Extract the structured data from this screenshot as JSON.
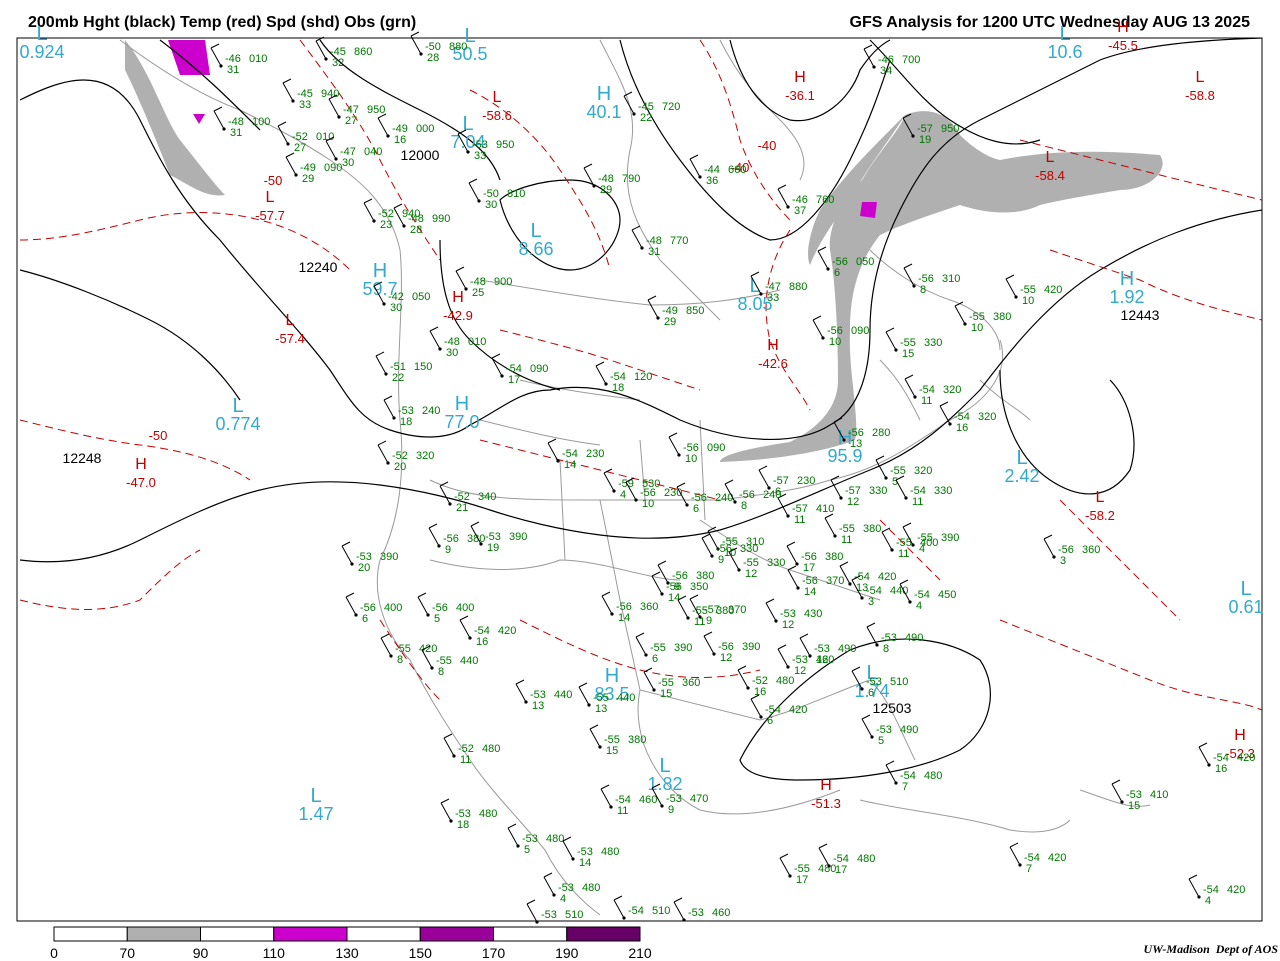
{
  "header": {
    "title_left": "200mb Hght (black) Temp (red) Spd (shd) Obs (grn)",
    "title_right": "GFS Analysis for 1200 UTC Wednesday  AUG 13 2025"
  },
  "colors": {
    "height_contour": "#000000",
    "temp_contour": "#c00000",
    "obs": "#007700",
    "centers": "#33aacc",
    "borders": "#9a9a9a",
    "speed_70_90": "#b0b0b0",
    "speed_110_130": "#cc00cc",
    "speed_150_170": "#990099",
    "speed_190_210": "#660066"
  },
  "colorbar": {
    "labels": [
      "0",
      "70",
      "90",
      "110",
      "130",
      "150",
      "170",
      "190",
      "210"
    ],
    "fills": [
      "#ffffff",
      "#b0b0b0",
      "#ffffff",
      "#cc00cc",
      "#ffffff",
      "#990099",
      "#ffffff",
      "#660066"
    ]
  },
  "credit": {
    "org": "UW-Madison",
    "dept": "Dept of AOS"
  },
  "height_labels": [
    "12000",
    "12240",
    "12248",
    "12443",
    "12503"
  ],
  "pressure_centers": [
    {
      "letter": "L",
      "value": "0.924",
      "color": "cyan"
    },
    {
      "letter": "L",
      "value": "50.5",
      "color": "cyan"
    },
    {
      "letter": "H",
      "value": "40.1",
      "color": "cyan"
    },
    {
      "letter": "L",
      "value": "7.04",
      "color": "cyan"
    },
    {
      "letter": "L",
      "value": "8.66",
      "color": "cyan"
    },
    {
      "letter": "H",
      "value": "59.7",
      "color": "cyan"
    },
    {
      "letter": "L",
      "value": "0.774",
      "color": "cyan"
    },
    {
      "letter": "H",
      "value": "77.0",
      "color": "cyan"
    },
    {
      "letter": "L",
      "value": "8.05",
      "color": "cyan"
    },
    {
      "letter": "L",
      "value": "10.6",
      "color": "cyan"
    },
    {
      "letter": "L",
      "value": "2.42",
      "color": "cyan"
    },
    {
      "letter": "H",
      "value": "95.9",
      "color": "cyan"
    },
    {
      "letter": "L",
      "value": "1.47",
      "color": "cyan"
    },
    {
      "letter": "H",
      "value": "83.5",
      "color": "cyan"
    },
    {
      "letter": "L",
      "value": "1.82",
      "color": "cyan"
    },
    {
      "letter": "L",
      "value": "1.74",
      "color": "cyan"
    },
    {
      "letter": "L",
      "value": "0.61",
      "color": "cyan"
    },
    {
      "letter": "H",
      "value": "1.92",
      "color": "cyan"
    },
    {
      "letter": "L",
      "value": "-57.7",
      "color": "red"
    },
    {
      "letter": "L",
      "value": "-57.4",
      "color": "red"
    },
    {
      "letter": "H",
      "value": "-47.0",
      "color": "red"
    },
    {
      "letter": "H",
      "value": "-42.9",
      "color": "red"
    },
    {
      "letter": "L",
      "value": "-58.6",
      "color": "red"
    },
    {
      "letter": "H",
      "value": "-42.6",
      "color": "red"
    },
    {
      "letter": "L",
      "value": "-58.4",
      "color": "red"
    },
    {
      "letter": "L",
      "value": "-58.8",
      "color": "red"
    },
    {
      "letter": "H",
      "value": "-45.5",
      "color": "red"
    },
    {
      "letter": "L",
      "value": "-58.2",
      "color": "red"
    },
    {
      "letter": "H",
      "value": "-51.3",
      "color": "red"
    },
    {
      "letter": "H",
      "value": "-52.3",
      "color": "red"
    },
    {
      "letter": "H",
      "value": "-36.1",
      "color": "red"
    },
    {
      "letter": "",
      "value": "-50",
      "color": "red"
    },
    {
      "letter": "",
      "value": "-50",
      "color": "red"
    },
    {
      "letter": "",
      "value": "-40",
      "color": "red"
    },
    {
      "letter": "",
      "value": "-40",
      "color": "red"
    }
  ],
  "observations": [
    {
      "t": "-45",
      "h": "860",
      "s": "32"
    },
    {
      "t": "-50",
      "h": "880",
      "s": "28"
    },
    {
      "t": "-46",
      "h": "010",
      "s": "31"
    },
    {
      "t": "-45",
      "h": "940",
      "s": "33"
    },
    {
      "t": "-47",
      "h": "950",
      "s": "27"
    },
    {
      "t": "-48",
      "h": "100",
      "s": "31"
    },
    {
      "t": "-52",
      "h": "010",
      "s": "27"
    },
    {
      "t": "-49",
      "h": "000",
      "s": "16"
    },
    {
      "t": "-47",
      "h": "040",
      "s": "30"
    },
    {
      "t": "-49",
      "h": "090",
      "s": "29"
    },
    {
      "t": "-53",
      "h": "950",
      "s": "33"
    },
    {
      "t": "-50",
      "h": "810",
      "s": "30"
    },
    {
      "t": "-52",
      "h": "940",
      "s": "23"
    },
    {
      "t": "-48",
      "h": "990",
      "s": "28"
    },
    {
      "t": "-48",
      "h": "900",
      "s": "25"
    },
    {
      "t": "-42",
      "h": "050",
      "s": "30"
    },
    {
      "t": "-48",
      "h": "010",
      "s": "30"
    },
    {
      "t": "-51",
      "h": "150",
      "s": "22"
    },
    {
      "t": "-54",
      "h": "090",
      "s": "17"
    },
    {
      "t": "-53",
      "h": "240",
      "s": "18"
    },
    {
      "t": "-52",
      "h": "320",
      "s": "20"
    },
    {
      "t": "-52",
      "h": "340",
      "s": "21"
    },
    {
      "t": "-54",
      "h": "230",
      "s": "14"
    },
    {
      "t": "-54",
      "h": "120",
      "s": "18"
    },
    {
      "t": "-48",
      "h": "770",
      "s": "31"
    },
    {
      "t": "-49",
      "h": "850",
      "s": "29"
    },
    {
      "t": "-48",
      "h": "790",
      "s": "29"
    },
    {
      "t": "-45",
      "h": "720",
      "s": "22"
    },
    {
      "t": "-44",
      "h": "660",
      "s": "36"
    },
    {
      "t": "-46",
      "h": "760",
      "s": "37"
    },
    {
      "t": "-47",
      "h": "880",
      "s": "33"
    },
    {
      "t": "-46",
      "h": "700",
      "s": "34"
    },
    {
      "t": "-57",
      "h": "950",
      "s": "19"
    },
    {
      "t": "-56",
      "h": "050",
      "s": "6"
    },
    {
      "t": "-56",
      "h": "310",
      "s": "8"
    },
    {
      "t": "-55",
      "h": "420",
      "s": "10"
    },
    {
      "t": "-56",
      "h": "090",
      "s": "10"
    },
    {
      "t": "-55",
      "h": "330",
      "s": "15"
    },
    {
      "t": "-55",
      "h": "380",
      "s": "10"
    },
    {
      "t": "-54",
      "h": "320",
      "s": "11"
    },
    {
      "t": "-54",
      "h": "320",
      "s": "16"
    },
    {
      "t": "-56",
      "h": "280",
      "s": "13"
    },
    {
      "t": "-55",
      "h": "320",
      "s": "5"
    },
    {
      "t": "-54",
      "h": "330",
      "s": "11"
    },
    {
      "t": "-56",
      "h": "090",
      "s": "10"
    },
    {
      "t": "-57",
      "h": "230",
      "s": "6"
    },
    {
      "t": "-57",
      "h": "330",
      "s": "12"
    },
    {
      "t": "-57",
      "h": "410",
      "s": "11"
    },
    {
      "t": "-55",
      "h": "380",
      "s": "11"
    },
    {
      "t": "-55",
      "h": "400",
      "s": "11"
    },
    {
      "t": "-56",
      "h": "380",
      "s": "17"
    },
    {
      "t": "-55",
      "h": "310",
      "s": "10"
    },
    {
      "t": "-55",
      "h": "330",
      "s": "12"
    },
    {
      "t": "-56",
      "h": "370",
      "s": "14"
    },
    {
      "t": "-54",
      "h": "420",
      "s": "13"
    },
    {
      "t": "-54",
      "h": "440",
      "s": "3"
    },
    {
      "t": "-54",
      "h": "450",
      "s": "4"
    },
    {
      "t": "-53",
      "h": "490",
      "s": "8"
    },
    {
      "t": "-53",
      "h": "510",
      "s": "6"
    },
    {
      "t": "-53",
      "h": "490",
      "s": "5"
    },
    {
      "t": "-53",
      "h": "490",
      "s": "12"
    },
    {
      "t": "-54",
      "h": "480",
      "s": "7"
    },
    {
      "t": "-53",
      "h": "430",
      "s": "12"
    },
    {
      "t": "-53",
      "h": "460",
      "s": "12"
    },
    {
      "t": "-52",
      "h": "480",
      "s": "16"
    },
    {
      "t": "-54",
      "h": "420",
      "s": "6"
    },
    {
      "t": "-56",
      "h": "390",
      "s": "12"
    },
    {
      "t": "-56",
      "h": "380",
      "s": "9"
    },
    {
      "t": "-57",
      "h": "370",
      "s": "9"
    },
    {
      "t": "-56",
      "h": "380",
      "s": "9"
    },
    {
      "t": "-53",
      "h": "390",
      "s": "19"
    },
    {
      "t": "-53",
      "h": "390",
      "s": "20"
    },
    {
      "t": "-56",
      "h": "400",
      "s": "6"
    },
    {
      "t": "-56",
      "h": "400",
      "s": "5"
    },
    {
      "t": "-54",
      "h": "420",
      "s": "16"
    },
    {
      "t": "-55",
      "h": "420",
      "s": "8"
    },
    {
      "t": "-55",
      "h": "440",
      "s": "8"
    },
    {
      "t": "-53",
      "h": "440",
      "s": "13"
    },
    {
      "t": "-55",
      "h": "440",
      "s": "13"
    },
    {
      "t": "-56",
      "h": "360",
      "s": "14"
    },
    {
      "t": "-55",
      "h": "390",
      "s": "6"
    },
    {
      "t": "-56",
      "h": "350",
      "s": "14"
    },
    {
      "t": "-55",
      "h": "360",
      "s": "15"
    },
    {
      "t": "-55",
      "h": "380",
      "s": "11"
    },
    {
      "t": "-55",
      "h": "380",
      "s": "15"
    },
    {
      "t": "-54",
      "h": "460",
      "s": "11"
    },
    {
      "t": "-53",
      "h": "470",
      "s": "9"
    },
    {
      "t": "-52",
      "h": "480",
      "s": "11"
    },
    {
      "t": "-53",
      "h": "480",
      "s": "18"
    },
    {
      "t": "-53",
      "h": "480",
      "s": "5"
    },
    {
      "t": "-53",
      "h": "480",
      "s": "14"
    },
    {
      "t": "-53",
      "h": "480",
      "s": "4"
    },
    {
      "t": "-53",
      "h": "510",
      "s": ""
    },
    {
      "t": "-54",
      "h": "510",
      "s": ""
    },
    {
      "t": "-53",
      "h": "460",
      "s": ""
    },
    {
      "t": "-55",
      "h": "480",
      "s": "17"
    },
    {
      "t": "-54",
      "h": "480",
      "s": "17"
    },
    {
      "t": "-54",
      "h": "420",
      "s": "7"
    },
    {
      "t": "-53",
      "h": "410",
      "s": "15"
    },
    {
      "t": "-54",
      "h": "420",
      "s": "16"
    },
    {
      "t": "-54",
      "h": "420",
      "s": "4"
    },
    {
      "t": "-56",
      "h": "360",
      "s": "3"
    },
    {
      "t": "-55",
      "h": "390",
      "s": "4"
    },
    {
      "t": "-59",
      "h": "530",
      "s": "4"
    },
    {
      "t": "-56",
      "h": "230",
      "s": "10"
    },
    {
      "t": "-56",
      "h": "240",
      "s": "6"
    },
    {
      "t": "-56",
      "h": "240",
      "s": "8"
    },
    {
      "t": "-56",
      "h": "330",
      "s": "9"
    }
  ]
}
